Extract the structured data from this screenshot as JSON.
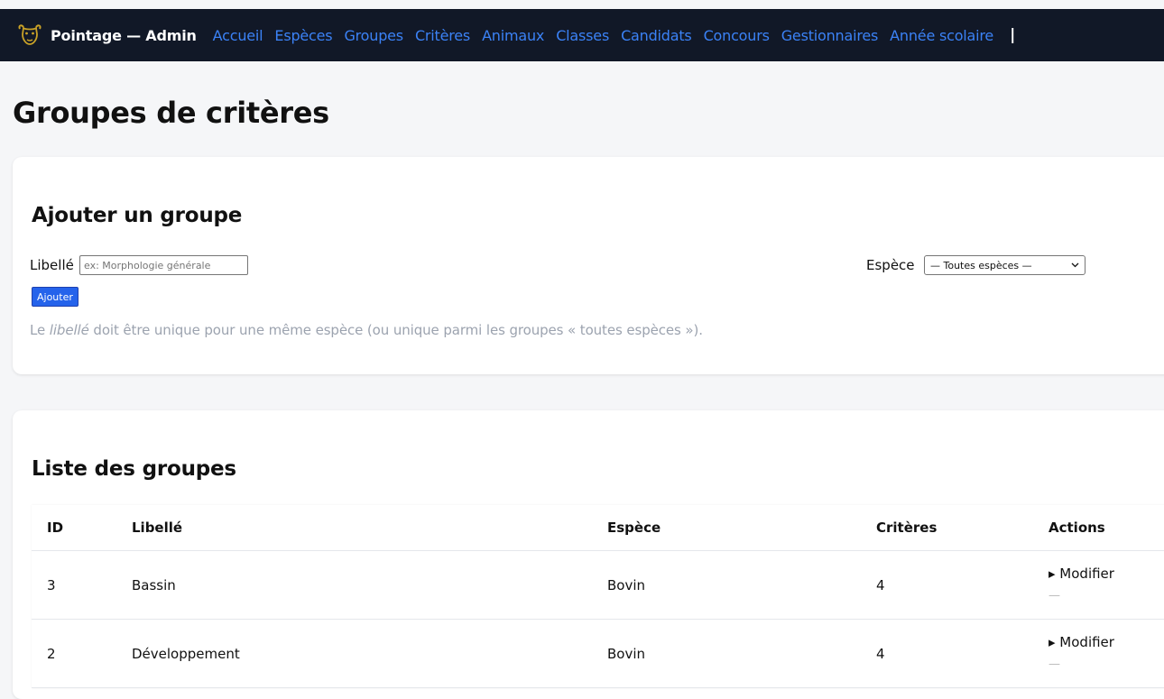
{
  "brand": "Pointage — Admin",
  "nav": [
    "Accueil",
    "Espèces",
    "Groupes",
    "Critères",
    "Animaux",
    "Classes",
    "Candidats",
    "Concours",
    "Gestionnaires",
    "Année scolaire"
  ],
  "nav_separator": "|",
  "page_title": "Groupes de critères",
  "add_form": {
    "title": "Ajouter un groupe",
    "libelle_label": "Libellé",
    "libelle_placeholder": "ex: Morphologie générale",
    "espece_label": "Espèce",
    "espece_selected": "— Toutes espèces —",
    "submit_label": "Ajouter",
    "hint_before": "Le ",
    "hint_em": "libellé",
    "hint_after": " doit être unique pour une même espèce (ou unique parmi les groupes « toutes espèces »)."
  },
  "list": {
    "title": "Liste des groupes",
    "headers": [
      "ID",
      "Libellé",
      "Espèce",
      "Critères",
      "Actions"
    ],
    "rows": [
      {
        "id": "3",
        "libelle": "Bassin",
        "espece": "Bovin",
        "criteres": "4",
        "action": "▸ Modifier",
        "action2": "—"
      },
      {
        "id": "2",
        "libelle": "Développement",
        "espece": "Bovin",
        "criteres": "4",
        "action": "▸ Modifier",
        "action2": "—"
      }
    ]
  },
  "colors": {
    "navbar": "#111827",
    "link": "#3b82f6",
    "button": "#2563eb",
    "hint": "#9ca3af"
  },
  "icons": {
    "logo": "bull-logo-icon",
    "select_chevron": "chevron-down-icon"
  }
}
